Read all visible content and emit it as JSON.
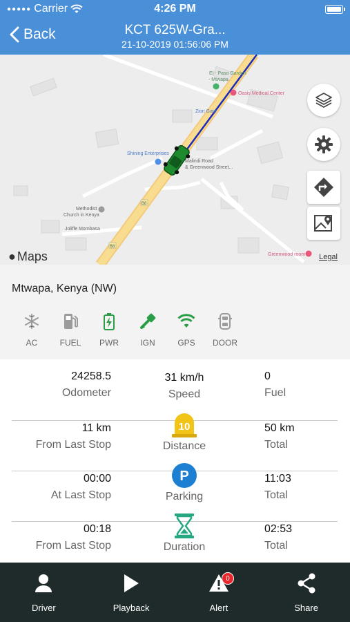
{
  "status_bar": {
    "carrier": "Carrier",
    "time": "4:26 PM"
  },
  "nav": {
    "back_label": "Back",
    "title": "KCT 625W-Gra...",
    "subtitle": "21-10-2019 01:56:06 PM"
  },
  "map": {
    "brand": "Maps",
    "legal": "Legal",
    "labels": {
      "el_paso_1": "El - Paso Garden",
      "el_paso_2": "- Mtwapa",
      "oasis": "Oasis Medical Center",
      "zion": "Zion Gate",
      "shining": "Shining Enterprises",
      "malindi_1": "Malindi Road",
      "malindi_2": "& Greenwood Street...",
      "methodist_1": "Methodist",
      "methodist_2": "Church in Kenya",
      "joliffe": "Joliffe Mombasa",
      "greenwood": "Greenwood room",
      "route_b8": "B8"
    },
    "buttons": {
      "layers": "layers-icon",
      "settings": "gear-icon",
      "directions": "directions-icon",
      "map_view": "map-view-icon"
    },
    "colors": {
      "road": "#f6d87a",
      "route": "#1e2bbd",
      "vehicle": "#1d8a2e"
    }
  },
  "location": "Mtwapa, Kenya (NW)",
  "sensors": [
    {
      "label": "AC",
      "icon": "snowflake-icon",
      "color": "#9b9b9b"
    },
    {
      "label": "FUEL",
      "icon": "fuel-pump-icon",
      "color": "#9b9b9b"
    },
    {
      "label": "PWR",
      "icon": "battery-icon",
      "color": "#2a9d46"
    },
    {
      "label": "IGN",
      "icon": "key-icon",
      "color": "#2a9d46"
    },
    {
      "label": "GPS",
      "icon": "wifi-icon",
      "color": "#2a9d46"
    },
    {
      "label": "DOOR",
      "icon": "car-door-icon",
      "color": "#9b9b9b"
    }
  ],
  "stats": {
    "row1": {
      "left": {
        "value": "24258.5",
        "label": "Odometer"
      },
      "center": {
        "value": "31 km/h",
        "label": "Speed"
      },
      "right": {
        "value": "0",
        "label": "Fuel"
      }
    },
    "row2": {
      "left": {
        "value": "11 km",
        "label": "From Last Stop"
      },
      "center": {
        "icon_value": "10",
        "label": "Distance",
        "icon": "distance-badge-icon"
      },
      "right": {
        "value": "50 km",
        "label": "Total"
      }
    },
    "row3": {
      "left": {
        "value": "00:00",
        "label": "At Last Stop"
      },
      "center": {
        "icon_value": "P",
        "label": "Parking",
        "icon": "parking-icon"
      },
      "right": {
        "value": "11:03",
        "label": "Total"
      }
    },
    "row4": {
      "left": {
        "value": "00:18",
        "label": "From Last Stop"
      },
      "center": {
        "label": "Duration",
        "icon": "hourglass-icon"
      },
      "right": {
        "value": "02:53",
        "label": "Total"
      }
    }
  },
  "tabs": [
    {
      "label": "Driver",
      "icon": "person-icon"
    },
    {
      "label": "Playback",
      "icon": "play-icon"
    },
    {
      "label": "Alert",
      "icon": "alert-icon",
      "badge": "0"
    },
    {
      "label": "Share",
      "icon": "share-icon"
    }
  ]
}
